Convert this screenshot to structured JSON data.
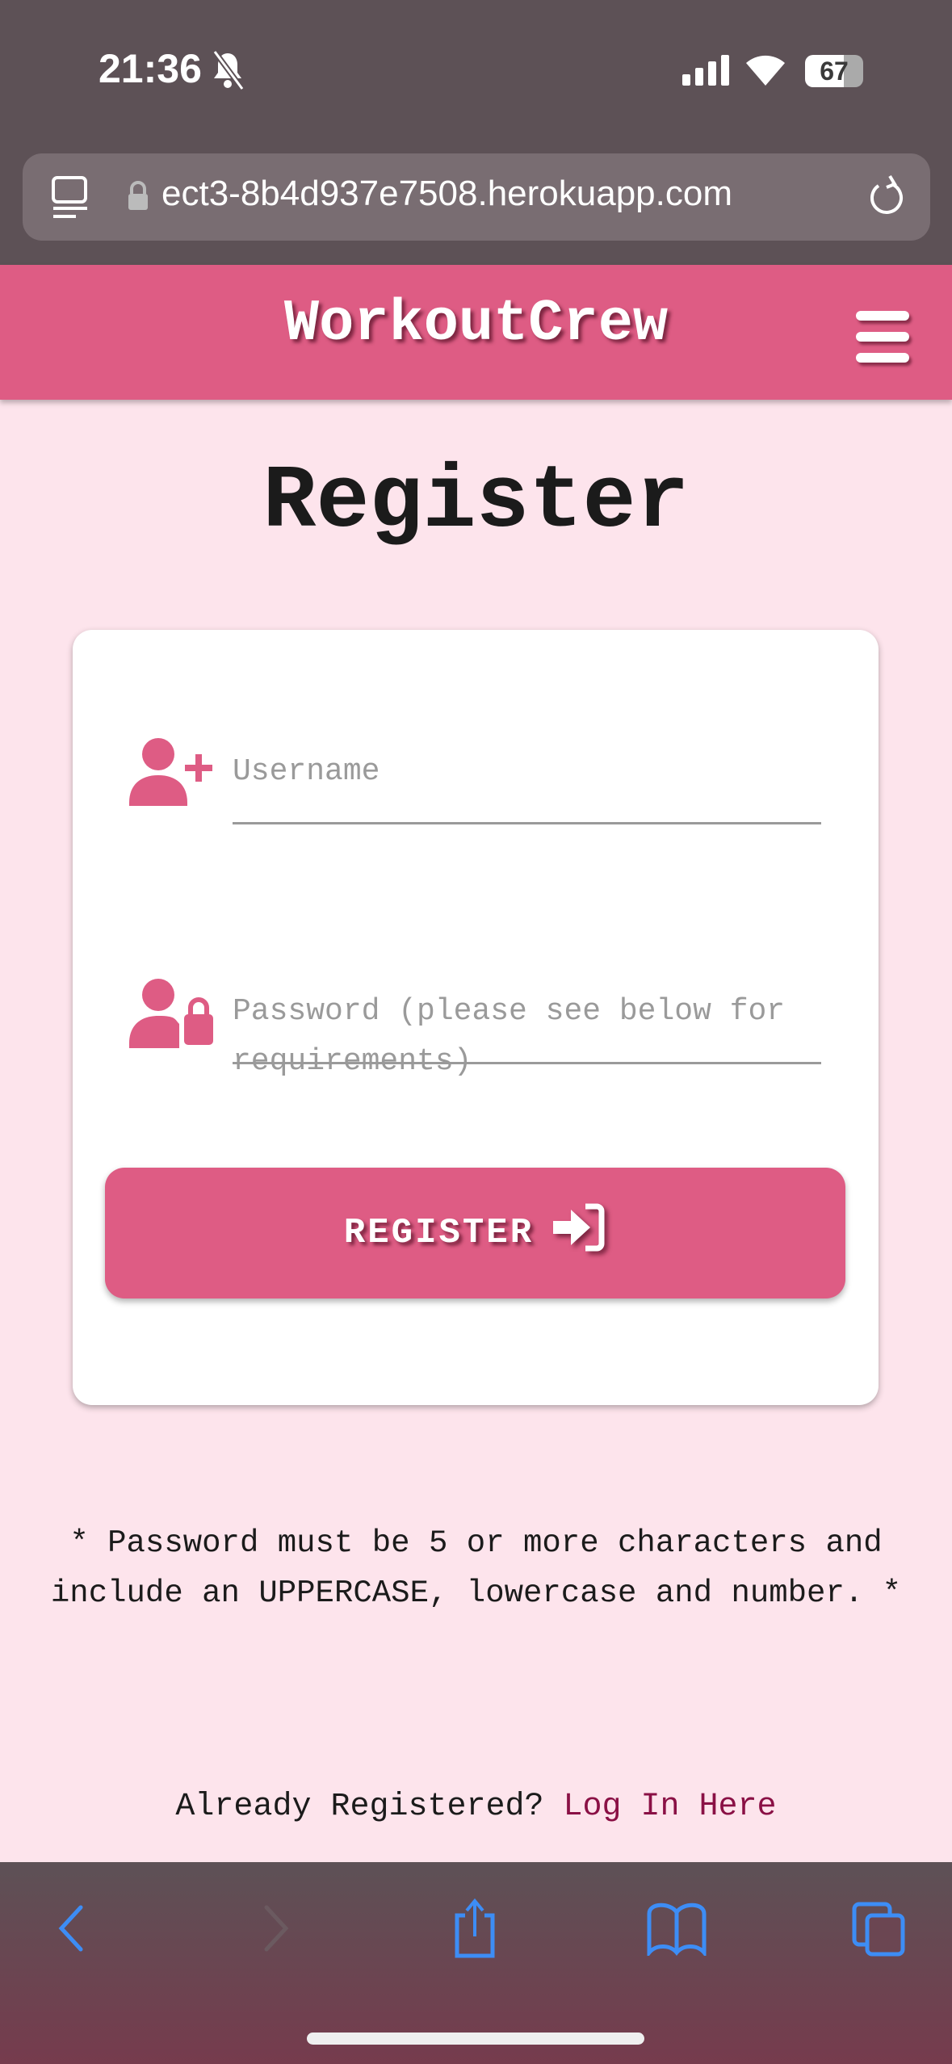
{
  "status_bar": {
    "time": "21:36",
    "battery": "67"
  },
  "browser": {
    "url": "ect3-8b4d937e7508.herokuapp.com"
  },
  "header": {
    "brand": "WorkoutCrew"
  },
  "page": {
    "title": "Register"
  },
  "form": {
    "username_placeholder": "Username",
    "password_placeholder": "Password (please see below for requirements)",
    "register_label": "REGISTER"
  },
  "note": "* Password must be 5 or more characters and include an UPPERCASE, lowercase and number. *",
  "login_prompt": {
    "text": "Already Registered?",
    "link": "Log In Here"
  },
  "colors": {
    "brand": "#de5c84",
    "background": "#fde4ec",
    "link": "#8a1045",
    "ios_blue": "#3d8df5"
  }
}
